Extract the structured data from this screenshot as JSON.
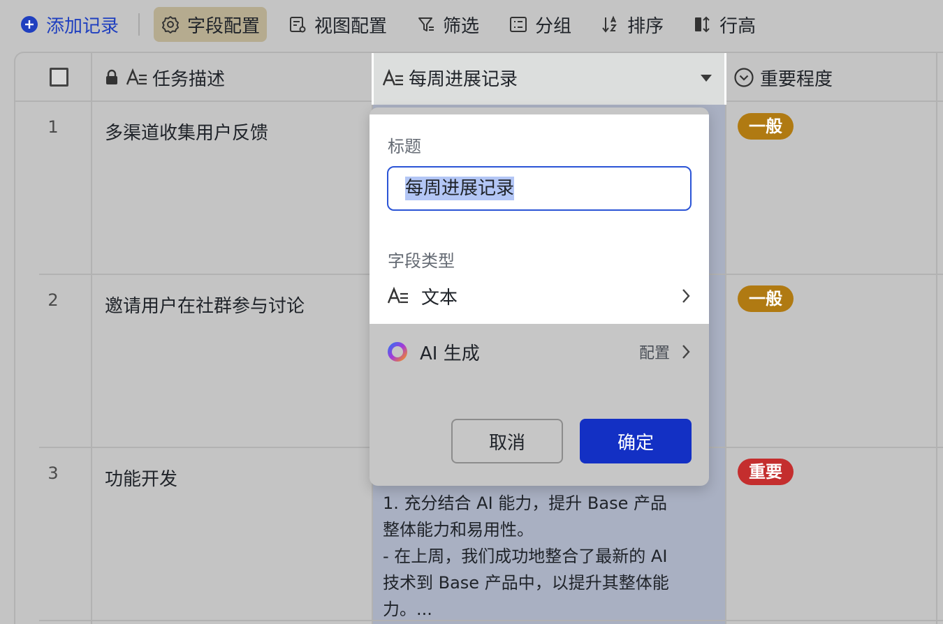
{
  "toolbar": {
    "add_record": "添加记录",
    "field_config": "字段配置",
    "view_config": "视图配置",
    "filter": "筛选",
    "group": "分组",
    "sort": "排序",
    "row_height": "行高"
  },
  "columns": {
    "task": "任务描述",
    "weekly": "每周进展记录",
    "importance": "重要程度"
  },
  "rows": [
    {
      "num": "1",
      "task": "多渠道收集用户反馈",
      "importance": "一般",
      "importance_color": "#b07a12"
    },
    {
      "num": "2",
      "task": "邀请用户在社群参与讨论",
      "importance": "一般",
      "importance_color": "#b07a12"
    },
    {
      "num": "3",
      "task": "功能开发",
      "importance": "重要",
      "importance_color": "#c42e2e",
      "weekly_lines": [
        "1. 充分结合 AI 能力，提升 Base 产品",
        "整体能力和易用性。",
        "- 在上周，我们成功地整合了最新的 AI",
        "技术到 Base 产品中，以提升其整体能",
        "力。..."
      ]
    }
  ],
  "popup": {
    "title_label": "标题",
    "title_value": "每周进展记录",
    "type_label": "字段类型",
    "type_value": "文本",
    "ai_label": "AI 生成",
    "ai_config": "配置",
    "cancel": "取消",
    "confirm": "确定"
  },
  "colors": {
    "accent": "#1330c4",
    "tag_normal": "#b07a12",
    "tag_important": "#c42e2e"
  }
}
